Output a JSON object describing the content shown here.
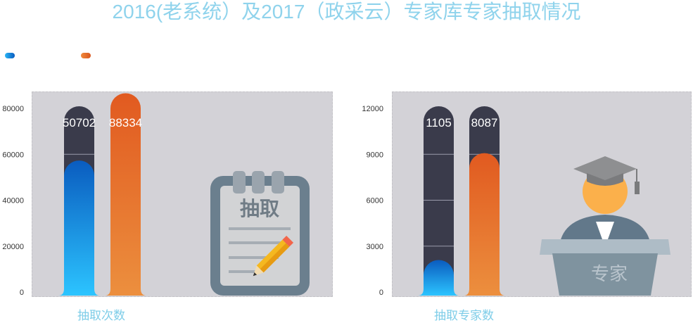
{
  "title": "2016(老系统）及2017（政采云）专家库专家抽取情况",
  "legend": {
    "items": [
      {
        "color": "#1a78c8"
      },
      {
        "color": "#e7702e"
      }
    ]
  },
  "chart_data": [
    {
      "type": "bar",
      "xlabel": "抽取次数",
      "yticks": [
        "0",
        "20000",
        "40000",
        "60000",
        "80000"
      ],
      "ylim": [
        0,
        80000
      ],
      "series": [
        {
          "values": [
            50702
          ],
          "color": "#1a78c8"
        },
        {
          "values": [
            88334
          ],
          "color": "#e7702e"
        }
      ],
      "data_labels": [
        "50702",
        "88334"
      ],
      "illustration_text": "抽取"
    },
    {
      "type": "bar",
      "xlabel": "抽取专家数",
      "yticks": [
        "0",
        "3000",
        "6000",
        "9000",
        "12000"
      ],
      "ylim": [
        0,
        12000
      ],
      "series": [
        {
          "values": [
            1105
          ],
          "color": "#1a78c8"
        },
        {
          "values": [
            8087
          ],
          "color": "#e7702e"
        }
      ],
      "data_labels": [
        "1105",
        "8087"
      ],
      "illustration_text": "专家"
    }
  ]
}
